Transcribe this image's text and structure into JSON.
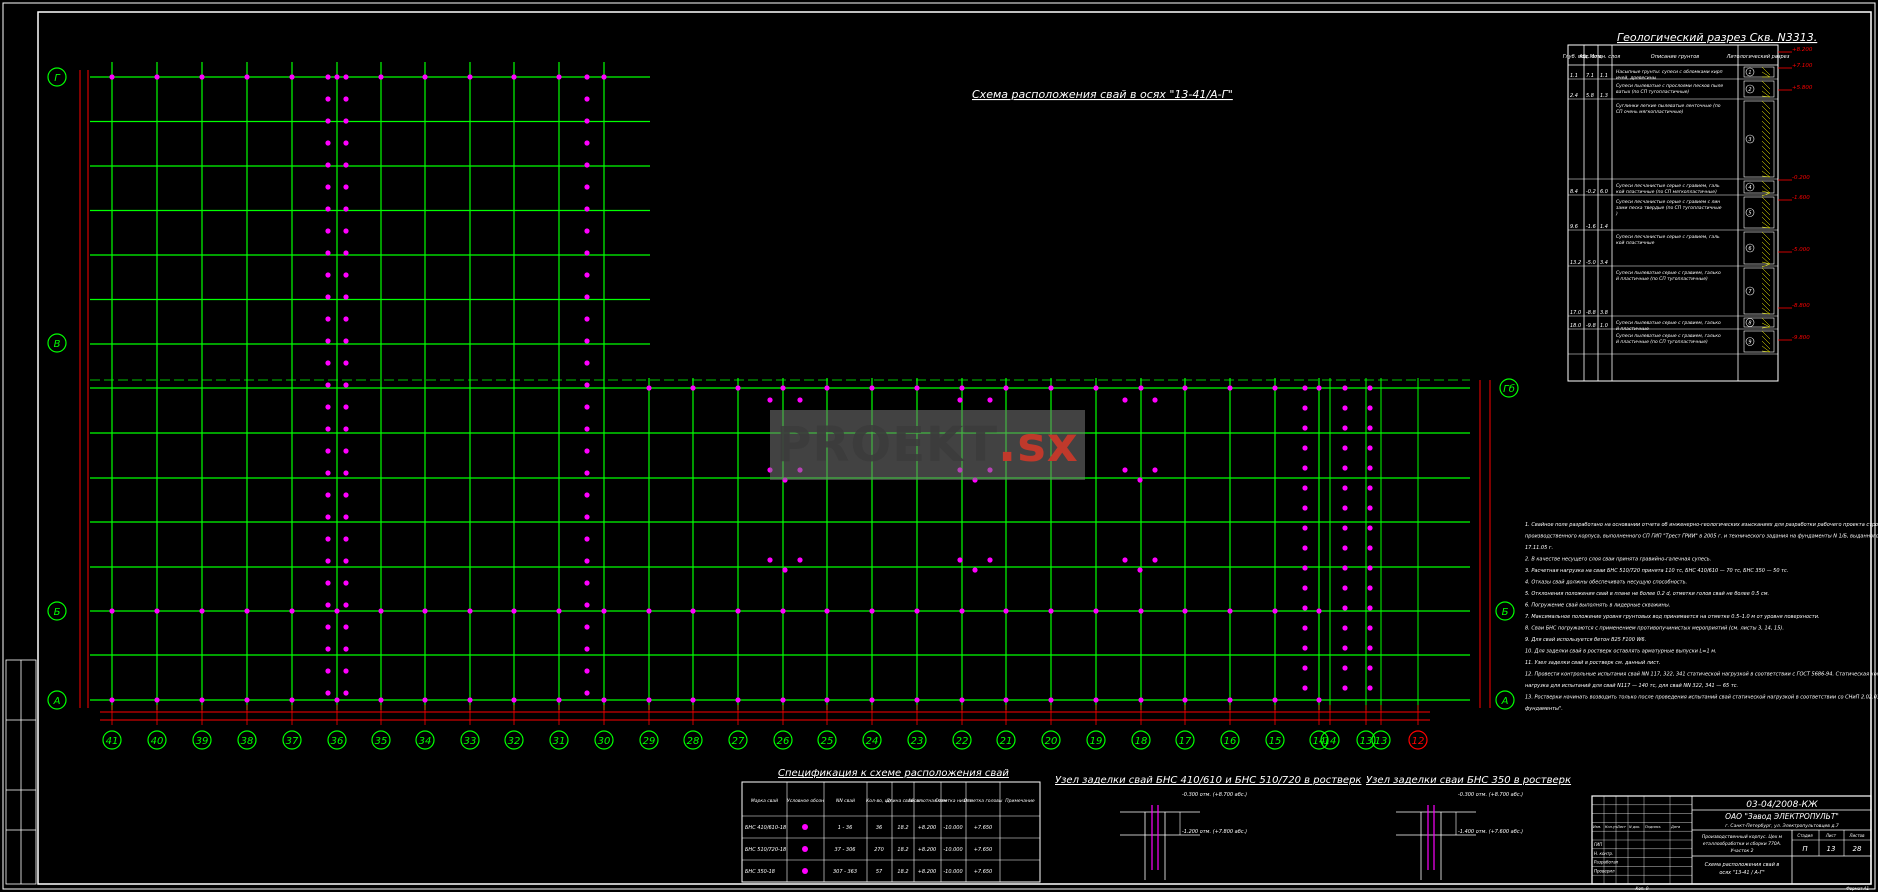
{
  "drawing": {
    "plan_title": "Схема расположения свай в осях \"13-41/А-Г\"",
    "geology_title": "Геологический разрез Скв. N3313.",
    "spec_title": "Спецификация к схеме расположения свай",
    "node1_title": "Узел заделки свай БНС 410/610 и БНС 510/720 в ростверк",
    "node2_title": "Узел заделки сваи БНС 350 в ростверк",
    "node1_labels": [
      "-0.300 отм. (+8.700 абс.)",
      "-1.200 отм. (+7.800 абс.)"
    ],
    "node2_labels": [
      "-0.300 отм. (+8.700 абс.)",
      "-1.400 отм. (+7.600 абс.)"
    ],
    "watermark": "PROEKT",
    "watermark_suffix": ".sx"
  },
  "axes": {
    "bottom": [
      "41",
      "40",
      "39",
      "38",
      "37",
      "36",
      "35",
      "34",
      "33",
      "32",
      "31",
      "30",
      "29",
      "28",
      "27",
      "26",
      "25",
      "24",
      "23",
      "22",
      "21",
      "20",
      "19",
      "18",
      "17",
      "16",
      "15",
      "14",
      "14",
      "13",
      "13",
      "12"
    ],
    "left": [
      "Г",
      "В",
      "Б",
      "А"
    ],
    "right": [
      "Б",
      "А"
    ],
    "right_top": "Гб"
  },
  "geology": {
    "headers": [
      "Глуб. под.",
      "Абс. отм.",
      "Мощн. слоя",
      "Описание грунтов",
      "Литологический разрез"
    ],
    "rows": [
      {
        "depth": "1.1",
        "abs": "7.1",
        "thk": "1.1",
        "desc": "Насыпные грунты: супеси с обломками кирпичей, древесины",
        "num": "1"
      },
      {
        "depth": "2.4",
        "abs": "5.8",
        "thk": "1.3",
        "desc": "Супеси пылеватые с прослоями песков пылеватых (по СП тугопластичные)",
        "num": "2"
      },
      {
        "depth": "",
        "abs": "",
        "thk": "",
        "desc": "Суглинки легкие пылеватые ленточные (по СП очень мягкопластичные)",
        "num": "3"
      },
      {
        "depth": "8.4",
        "abs": "-0.2",
        "thk": "6.0",
        "desc": "Супеси песчанистые серые с гравием, галькой пластичные (по СП мягкопластичные)",
        "num": "4"
      },
      {
        "depth": "9.6",
        "abs": "-1.6",
        "thk": "1.4",
        "desc": "Супеси песчанистые серые с гравием с линзами песка твердые (по СП тугопластичные)",
        "num": "5"
      },
      {
        "depth": "13.2",
        "abs": "-5.0",
        "thk": "3.4",
        "desc": "Супеси песчанистые серые с гравием, галькой пластичные",
        "num": "6"
      },
      {
        "depth": "17.0",
        "abs": "-8.8",
        "thk": "3.8",
        "desc": "Супеси пылеватые серые с гравием, галькой пластичные (по СП тугопластичные)",
        "num": "7"
      },
      {
        "depth": "18.0",
        "abs": "-9.8",
        "thk": "1.0",
        "desc": "Супеси пылеватые серые с гравием, галькой пластичные",
        "num": "8"
      },
      {
        "depth": "",
        "abs": "",
        "thk": "",
        "desc": "Супеси пылеватые серые с гравием, галькой пластичные (по СП тугопластичные)",
        "num": "9"
      }
    ],
    "level_marks": [
      "+8.200",
      "+7.100",
      "+5.800",
      "-0.200",
      "-1.600",
      "-5.000",
      "-8.800",
      "-9.800"
    ]
  },
  "spec": {
    "headers": [
      "Марка свай",
      "Условное обозначение",
      "NN свай",
      "Кол-во, шт.",
      "Длина сваи, м",
      "Абсолютная отм. головы сваи",
      "Отметка низа сваи",
      "Отметка головы сваи после срубки",
      "Примечание"
    ],
    "rows": [
      {
        "mark": "БНС 410/610-18",
        "range": "1 - 36",
        "qty": "36",
        "len": "18.2",
        "top": "+8.200",
        "bottom": "-10.000",
        "cut": "+7.650"
      },
      {
        "mark": "БНС 510/720-18",
        "range": "37 - 306",
        "qty": "270",
        "len": "18.2",
        "top": "+8.200",
        "bottom": "-10.000",
        "cut": "+7.650"
      },
      {
        "mark": "БНС 350-18",
        "range": "307 - 363",
        "qty": "57",
        "len": "18.2",
        "top": "+8.200",
        "bottom": "-10.000",
        "cut": "+7.650"
      }
    ]
  },
  "notes": [
    "1.  Свайное поле разработано на основании отчета об инженерно-геологических изысканиях для разработки рабочего проекта строительства производственного корпуса, выполненного СП ГИП \"Трест ГРИИ\" в 2005 г. и технического задания на фундаменты N 1/Б, выданного ООО\"Ленпанели\" 17.11.05 г.",
    "2.  В качестве несущего слоя сваи принята гравийно-галечная супесь.",
    "3.  Расчетная нагрузка на сваи БНС 510/720 принята 110 тс, БНС 410/610 — 70 тс, БНС 350 — 50 тс.",
    "4.  Отказы свай должны обеспечивать несущую способность.",
    "5.  Отклонения положения свай в плане не более 0.2 d, отметки голов свай не более 0.5 см.",
    "6.  Погружение свай выполнять в лидерные скважины.",
    "7.  Максимальное положение уровня грунтовых вод принимается на отметке 0.5–1.0 м от уровня поверхности.",
    "8.  Сваи БНС погружаются с применением противопучинистых мероприятий (см. листы 3, 14, 15).",
    "9.  Для свай используется бетон B25 F100 W6.",
    "10. Для заделки свай в ростверк оставлять арматурные выпуски L=1 м.",
    "11. Узел заделки свай в ростверк см. данный лист.",
    "12. Провести контрольные испытания свай NN 117, 322, 341 статической нагрузкой в соответствии с ГОСТ 5686-94. Статическая контрольная нагрузка для испытаний для свай N117 — 140 тс, для свай NN 322, 341 — 65 тс.",
    "13. Ростверки начинать возводить только после проведения испытаний свай статической нагрузкой в соответствии со СНиП 2.02.03-85 \"Свайные фундаменты\"."
  ],
  "titleblock": {
    "code": "03-04/2008-КЖ",
    "company": "ОАО \"Завод ЭЛЕКТРОПУЛЬТ\"",
    "address": "г. Санкт-Петербург, ул. Электропультовцев д.7",
    "object": "Производственный корпус. Цех металлообработки и сборки 770А. Участок 2",
    "sheet_name": "Схема расположения свай в осях \"13-41 / А-Г\"",
    "stage_h": "Стадия",
    "sheet_h": "Лист",
    "sheets_h": "Листов",
    "stage": "П",
    "sheet": "13",
    "sheets": "28",
    "format": "Формат А1",
    "copied": "Коп. 9",
    "head_labels": [
      "Изм.",
      "Кол.уч.",
      "Лист",
      "N док.",
      "Подпись",
      "Дата"
    ],
    "staff": [
      "ГИП",
      "Н. контр.",
      "Разработал",
      "Проверил"
    ]
  },
  "colors": {
    "background": "#000000",
    "axis_lines": "#00ff00",
    "piles": "#ff00ff",
    "dimensions": "#ff0000",
    "text": "#ffffff",
    "hatch": "#ffff00"
  }
}
